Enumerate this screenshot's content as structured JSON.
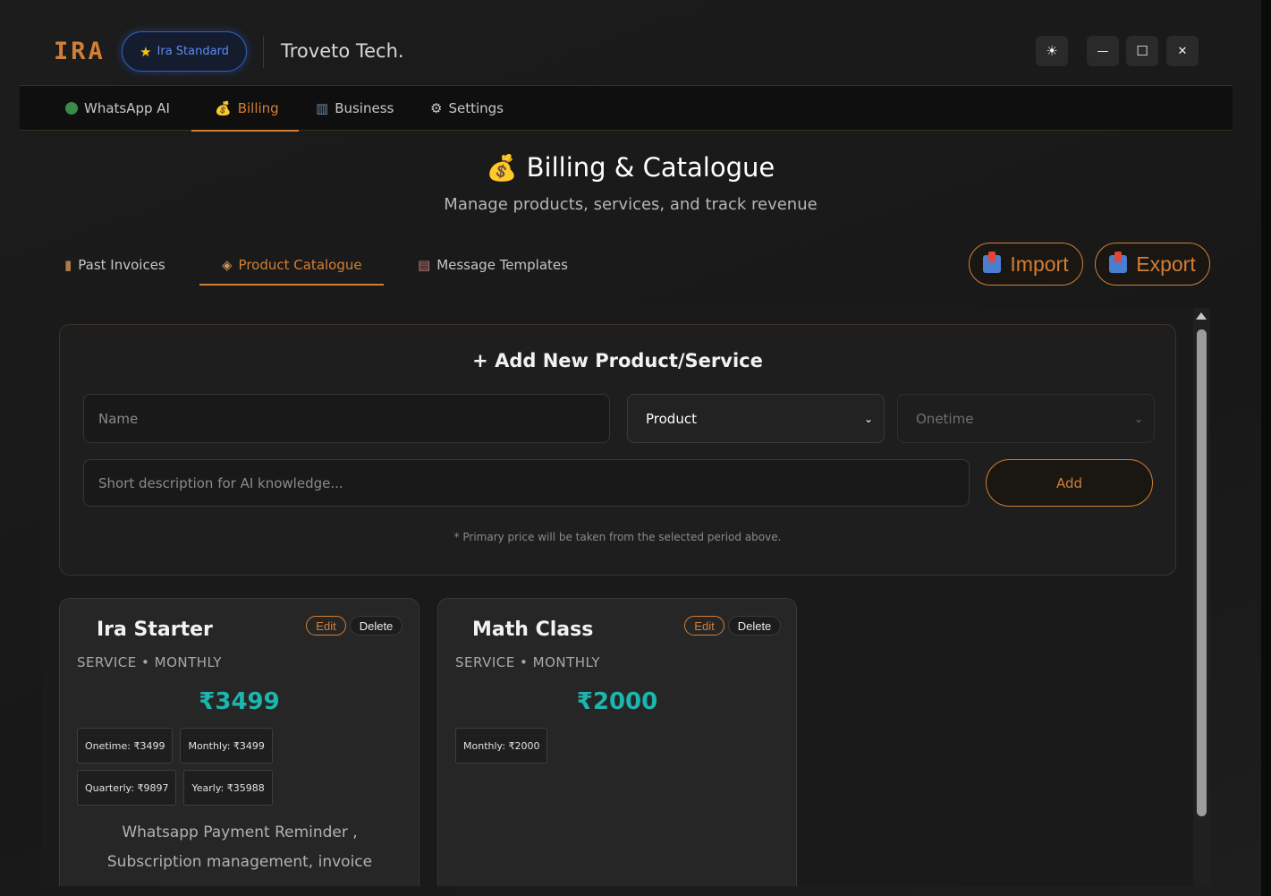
{
  "header": {
    "logo": "IRA",
    "plan_badge": "Ira Standard",
    "company": "Troveto Tech.",
    "controls": {
      "theme": "☀",
      "minimize": "—",
      "maximize": "☐",
      "close": "✕"
    }
  },
  "main_nav": {
    "tabs": [
      {
        "label": "WhatsApp AI",
        "active": false
      },
      {
        "label": "Billing",
        "active": true
      },
      {
        "label": "Business",
        "active": false
      },
      {
        "label": "Settings",
        "active": false
      }
    ]
  },
  "page": {
    "title": "Billing & Catalogue",
    "subtitle": "Manage products, services, and track revenue"
  },
  "sub_tabs": [
    {
      "label": "Past Invoices",
      "active": false
    },
    {
      "label": "Product Catalogue",
      "active": true
    },
    {
      "label": "Message Templates",
      "active": false
    }
  ],
  "actions": {
    "import_label": "Import",
    "export_label": "Export"
  },
  "add_form": {
    "title": "+ Add New Product/Service",
    "name_placeholder": "Name",
    "type_selected": "Product",
    "period_selected": "Onetime",
    "description_placeholder": "Short description for AI knowledge...",
    "add_label": "Add",
    "note": "* Primary price will be taken from the selected period above."
  },
  "products": [
    {
      "name": "Ira Starter",
      "meta": "SERVICE • MONTHLY",
      "price": "₹3499",
      "edit_label": "Edit",
      "delete_label": "Delete",
      "chips": [
        "Onetime: ₹3499",
        "Monthly: ₹3499",
        "Quarterly: ₹9897",
        "Yearly: ₹35988"
      ],
      "description": "Whatsapp Payment Reminder , Subscription management, invoice"
    },
    {
      "name": "Math Class",
      "meta": "SERVICE • MONTHLY",
      "price": "₹2000",
      "edit_label": "Edit",
      "delete_label": "Delete",
      "chips": [
        "Monthly: ₹2000"
      ],
      "description": ""
    }
  ],
  "colors": {
    "accent": "#d27f35",
    "price": "#1db5ad",
    "badge_blue": "#2e62c9",
    "background": "#1a1a1a"
  }
}
